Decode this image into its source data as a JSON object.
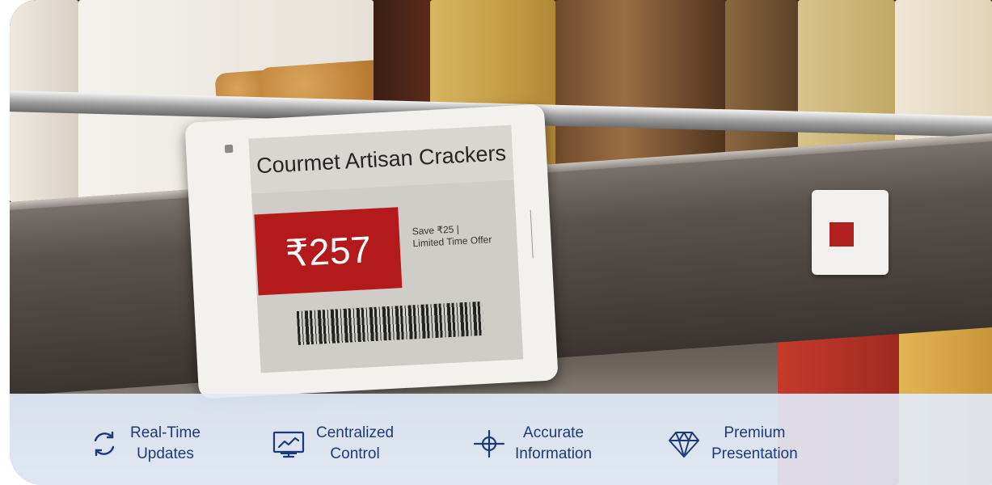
{
  "colors": {
    "accent": "#1b3b78",
    "feature_bar": "#e1e9f6",
    "price_red": "#b4191c"
  },
  "shelf_label": {
    "product_name": "Courmet Artisan Crackers",
    "price": "₹257",
    "promo_line1": "Save ₹25 |",
    "promo_line2": "Limited Time Offer"
  },
  "features": [
    {
      "icon": "refresh-icon",
      "line1": "Real-Time",
      "line2": "Updates"
    },
    {
      "icon": "monitor-chart-icon",
      "line1": "Centralized",
      "line2": "Control"
    },
    {
      "icon": "crosshair-icon",
      "line1": "Accurate",
      "line2": "Information"
    },
    {
      "icon": "diamond-icon",
      "line1": "Premium",
      "line2": "Presentation"
    }
  ]
}
